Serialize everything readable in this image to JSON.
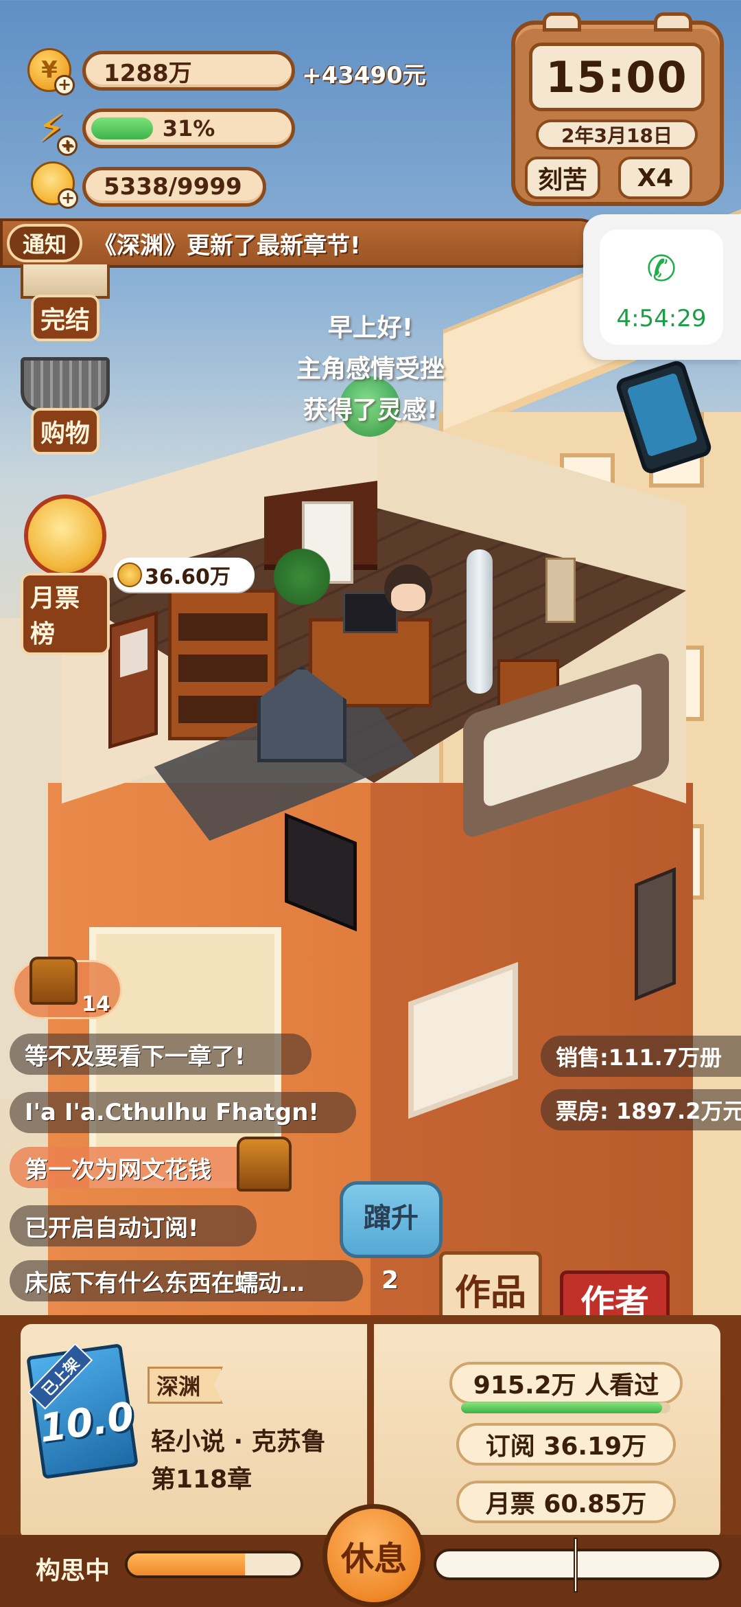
{
  "hud": {
    "coins": "1288万",
    "income": "+43490元",
    "energy_percent": "31%",
    "energy_value": 0.31,
    "ideas": "5338/9999"
  },
  "clock": {
    "time": "15:00",
    "date": "2年3月18日",
    "diligent_label": "刻苦",
    "speed_label": "X4"
  },
  "notice": {
    "tag": "通知",
    "text": "《深渊》更新了最新章节!"
  },
  "call": {
    "timer": "4:54:29"
  },
  "menu": {
    "finish_label": "完结",
    "shop_label": "购物",
    "rank_label": "月票榜",
    "rank_value": "36.60万"
  },
  "floating": {
    "line1": "早上好!",
    "line2": "主角感情受挫",
    "line3": "获得了灵感!"
  },
  "chest": {
    "count": "14"
  },
  "chat": [
    "等不及要看下一章了!",
    "I'a I'a.Cthulhu Fhatgn!",
    "第一次为网文花钱",
    "已开启自动订阅!",
    "床底下有什么东西在蠕动…"
  ],
  "chat_count": "2",
  "sales": {
    "sold": "销售:111.7万册",
    "box_office": "票房: 1897.2万元"
  },
  "rise_label": "蹿升",
  "tabs": {
    "works": "作品",
    "author": "作者"
  },
  "novel": {
    "badge": "已上架",
    "score": "10.0",
    "name": "深渊",
    "genre": "轻小说 · 克苏鲁",
    "chapter": "第118章",
    "views": "915.2万 人看过",
    "views_progress": 0.96,
    "subscriptions": "订阅 36.19万",
    "monthly_tickets": "月票 60.85万"
  },
  "bottom": {
    "thinking_label": "构思中",
    "thinking_progress": 0.68,
    "rest_label": "休息"
  }
}
